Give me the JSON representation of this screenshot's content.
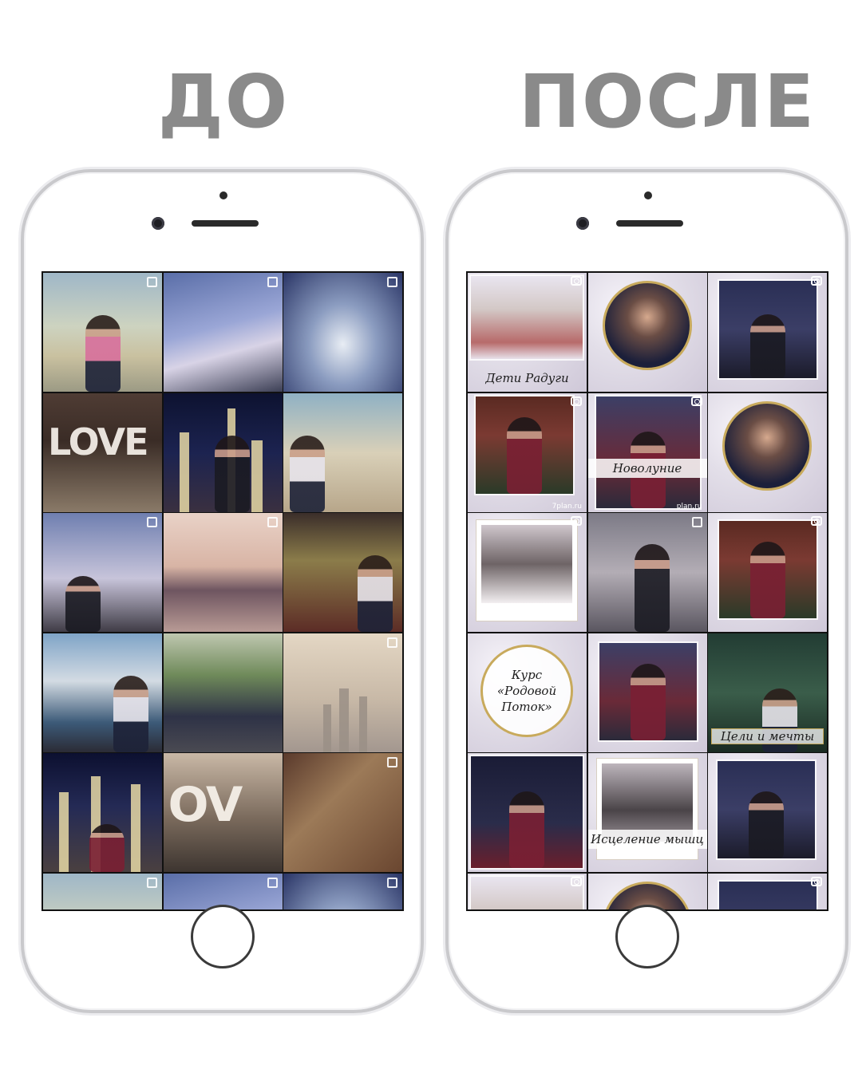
{
  "headings": {
    "before": "ДО",
    "after": "ПОСЛЕ"
  },
  "before_grid": {
    "tiles": [
      "beach-woman",
      "plane-wing",
      "clouds-aerial",
      "love-sign",
      "night-city",
      "sports-car",
      "palm-sunset",
      "lake-sunset",
      "flower-shop",
      "pool-view",
      "lamborghini",
      "dubai-skyline",
      "marina-night",
      "love-sign-2",
      "sweets-gifts",
      "beach-woman",
      "plane-wing",
      "clouds-aerial"
    ]
  },
  "after_grid": {
    "captions": {
      "deti_radugi": "Дети Радуги",
      "novolunie": "Новолуние",
      "kurs": "Курс\n«Родовой\nПоток»",
      "celi": "Цели и мечты",
      "iscelenie": "Исцеление мышц",
      "watermark": "7plan.ru",
      "watermark2": "plan.ru"
    }
  },
  "colors": {
    "heading": "#8a8a8a",
    "frame_gold": "#c8aa5c",
    "phone_border": "#c9c9cc"
  }
}
